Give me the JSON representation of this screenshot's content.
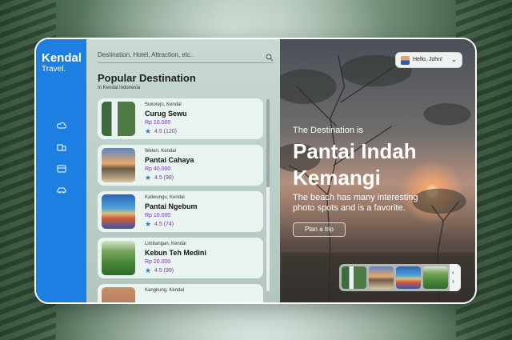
{
  "brand": {
    "line1": "Kendal",
    "line2": "Travel."
  },
  "rail_icons": [
    "cloud-icon",
    "building-icon",
    "store-icon",
    "car-icon"
  ],
  "search": {
    "placeholder": "Destination, Hotel, Attraction, etc.."
  },
  "section": {
    "title": "Popular Destination",
    "subtitle": "In Kendal Indonesia"
  },
  "destinations": [
    {
      "location": "Sukorejo, Kendal",
      "name": "Curug Sewu",
      "price": "Rp 10.000",
      "rating": "4.5 (120)",
      "image": "waterfall"
    },
    {
      "location": "Weleri, Kendal",
      "name": "Pantai Cahaya",
      "price": "Rp 40.000",
      "rating": "4.5 (98)",
      "image": "sunset"
    },
    {
      "location": "Kaliwungu, Kendal",
      "name": "Pantai Ngebum",
      "price": "Rp 10.000",
      "rating": "4.5 (74)",
      "image": "beach"
    },
    {
      "location": "Limbangan, Kendal",
      "name": "Kebun Teh Medini",
      "price": "Rp 20.000",
      "rating": "4.5 (99)",
      "image": "tea-garden"
    },
    {
      "location": "Kangkung, Kendal",
      "name": "",
      "price": "",
      "rating": "",
      "image": "partial"
    }
  ],
  "user": {
    "greeting": "Hello, John!"
  },
  "hero": {
    "eyebrow": "The Destination is",
    "title": "Pantai Indah Kemangi",
    "description": "The beach has many interesting photo spots and is a favorite.",
    "cta": "Plan a trip"
  },
  "colors": {
    "accent": "#1e7fe3",
    "price": "#7b2fb8",
    "card": "#e9f4f1"
  }
}
